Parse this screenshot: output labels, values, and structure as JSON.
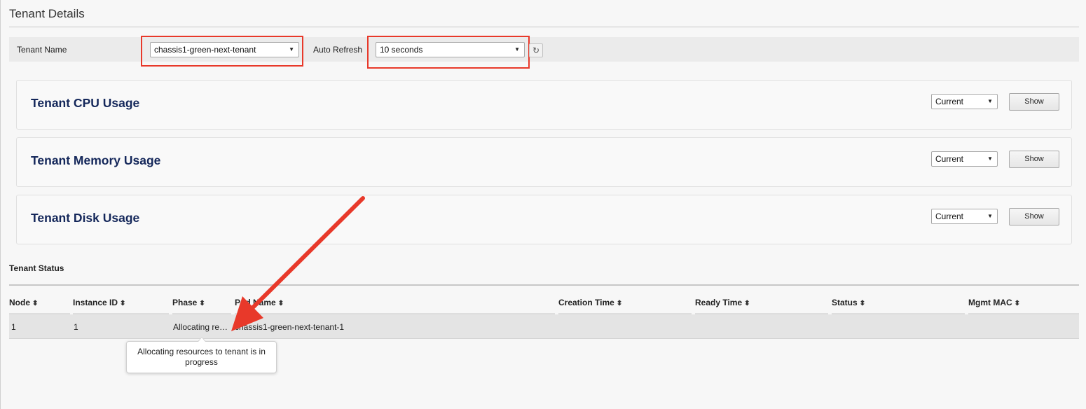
{
  "page": {
    "title": "Tenant Details"
  },
  "filters": {
    "tenant_name_label": "Tenant Name",
    "tenant_name_value": "chassis1-green-next-tenant",
    "auto_refresh_label": "Auto Refresh",
    "auto_refresh_value": "10 seconds",
    "refresh_icon": "refresh-icon",
    "caret_icon": "▼",
    "refresh_glyph": "↻"
  },
  "panels": [
    {
      "title": "Tenant CPU Usage",
      "range_value": "Current",
      "button_label": "Show"
    },
    {
      "title": "Tenant Memory Usage",
      "range_value": "Current",
      "button_label": "Show"
    },
    {
      "title": "Tenant Disk Usage",
      "range_value": "Current",
      "button_label": "Show"
    }
  ],
  "status": {
    "title": "Tenant Status",
    "sort_glyph": "⬍",
    "columns": [
      "Node",
      "Instance ID",
      "Phase",
      "Pod Name",
      "Creation Time",
      "Ready Time",
      "Status",
      "Mgmt MAC"
    ],
    "rows": [
      {
        "node": "1",
        "instance_id": "1",
        "phase": "Allocating re…",
        "pod_name": "chassis1-green-next-tenant-1",
        "creation_time": "",
        "ready_time": "",
        "status": "",
        "mgmt_mac": ""
      }
    ],
    "tooltip": "Allocating resources to tenant is in progress"
  },
  "annotation": {
    "color": "#e8392a",
    "arrow_icon": "arrow-icon"
  }
}
